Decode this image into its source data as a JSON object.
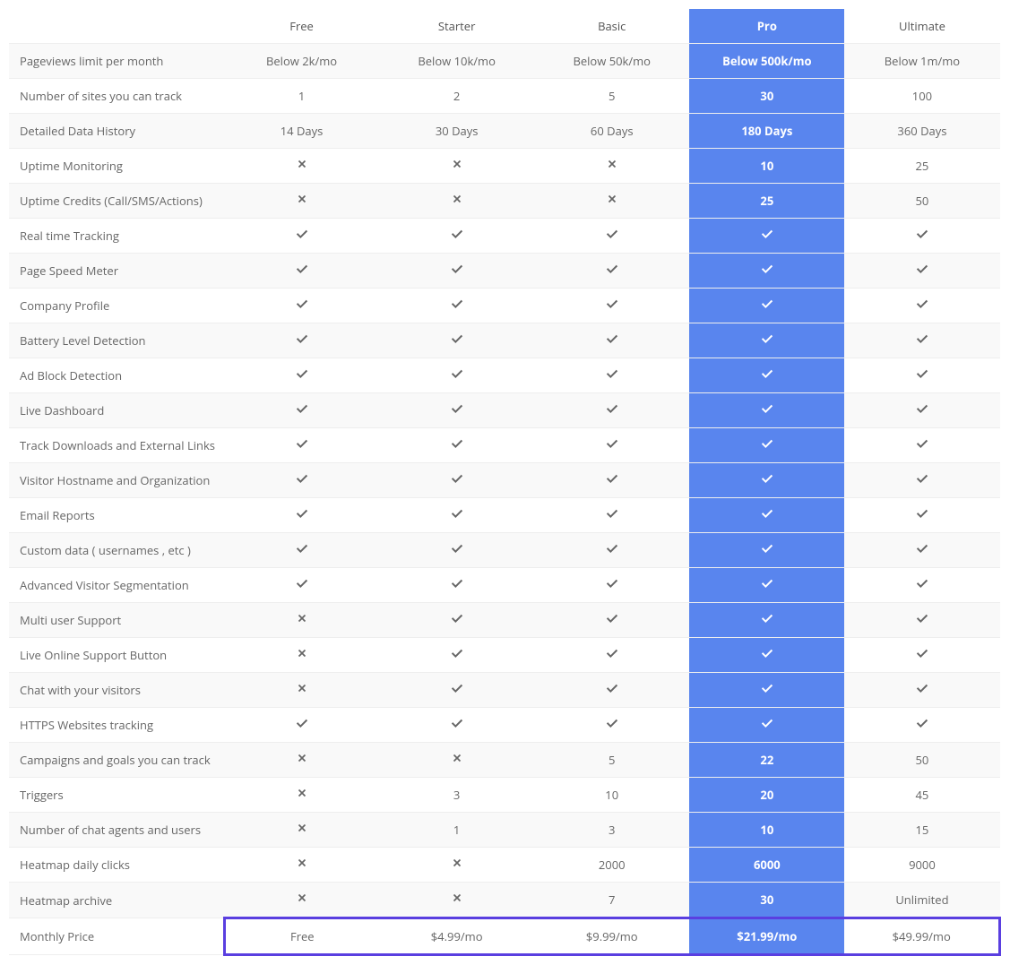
{
  "plans": [
    "Free",
    "Starter",
    "Basic",
    "Pro",
    "Ultimate"
  ],
  "highlight_plan_index": 3,
  "rows": [
    {
      "label": "Pageviews limit per month",
      "values": [
        "Below 2k/mo",
        "Below 10k/mo",
        "Below 50k/mo",
        "Below 500k/mo",
        "Below 1m/mo"
      ]
    },
    {
      "label": "Number of sites you can track",
      "values": [
        "1",
        "2",
        "5",
        "30",
        "100"
      ]
    },
    {
      "label": "Detailed Data History",
      "values": [
        "14 Days",
        "30 Days",
        "60 Days",
        "180 Days",
        "360 Days"
      ]
    },
    {
      "label": "Uptime Monitoring",
      "values": [
        "x",
        "x",
        "x",
        "10",
        "25"
      ]
    },
    {
      "label": "Uptime Credits (Call/SMS/Actions)",
      "values": [
        "x",
        "x",
        "x",
        "25",
        "50"
      ]
    },
    {
      "label": "Real time Tracking",
      "values": [
        "check",
        "check",
        "check",
        "check",
        "check"
      ]
    },
    {
      "label": "Page Speed Meter",
      "values": [
        "check",
        "check",
        "check",
        "check",
        "check"
      ]
    },
    {
      "label": "Company Profile",
      "values": [
        "check",
        "check",
        "check",
        "check",
        "check"
      ]
    },
    {
      "label": "Battery Level Detection",
      "values": [
        "check",
        "check",
        "check",
        "check",
        "check"
      ]
    },
    {
      "label": "Ad Block Detection",
      "values": [
        "check",
        "check",
        "check",
        "check",
        "check"
      ]
    },
    {
      "label": "Live Dashboard",
      "values": [
        "check",
        "check",
        "check",
        "check",
        "check"
      ]
    },
    {
      "label": "Track Downloads and External Links",
      "values": [
        "check",
        "check",
        "check",
        "check",
        "check"
      ]
    },
    {
      "label": "Visitor Hostname and Organization",
      "values": [
        "check",
        "check",
        "check",
        "check",
        "check"
      ]
    },
    {
      "label": "Email Reports",
      "values": [
        "check",
        "check",
        "check",
        "check",
        "check"
      ]
    },
    {
      "label": "Custom data ( usernames , etc )",
      "values": [
        "check",
        "check",
        "check",
        "check",
        "check"
      ]
    },
    {
      "label": "Advanced Visitor Segmentation",
      "values": [
        "check",
        "check",
        "check",
        "check",
        "check"
      ]
    },
    {
      "label": "Multi user Support",
      "values": [
        "x",
        "check",
        "check",
        "check",
        "check"
      ]
    },
    {
      "label": "Live Online Support Button",
      "values": [
        "x",
        "check",
        "check",
        "check",
        "check"
      ]
    },
    {
      "label": "Chat with your visitors",
      "values": [
        "x",
        "check",
        "check",
        "check",
        "check"
      ]
    },
    {
      "label": "HTTPS Websites tracking",
      "values": [
        "check",
        "check",
        "check",
        "check",
        "check"
      ]
    },
    {
      "label": "Campaigns and goals you can track",
      "values": [
        "x",
        "x",
        "5",
        "22",
        "50"
      ]
    },
    {
      "label": "Triggers",
      "values": [
        "x",
        "3",
        "10",
        "20",
        "45"
      ]
    },
    {
      "label": "Number of chat agents and users",
      "values": [
        "x",
        "1",
        "3",
        "10",
        "15"
      ]
    },
    {
      "label": "Heatmap daily clicks",
      "values": [
        "x",
        "x",
        "2000",
        "6000",
        "9000"
      ]
    },
    {
      "label": "Heatmap archive",
      "values": [
        "x",
        "x",
        "7",
        "30",
        "Unlimited"
      ]
    }
  ],
  "price_row": {
    "label": "Monthly Price",
    "values": [
      "Free",
      "$4.99/mo",
      "$9.99/mo",
      "$21.99/mo",
      "$49.99/mo"
    ]
  }
}
